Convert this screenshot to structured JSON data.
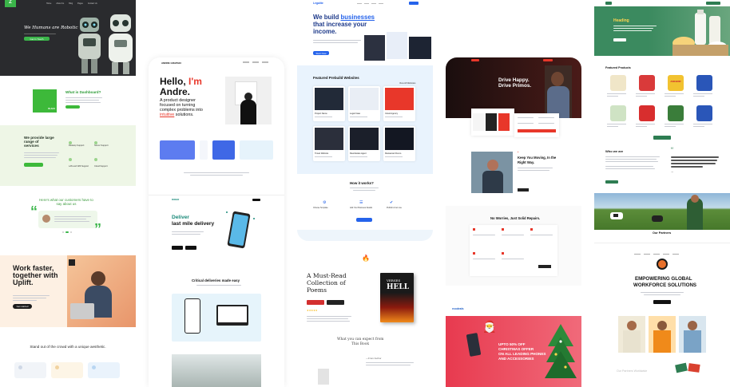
{
  "col1": {
    "hero_logo": "Z",
    "hero_nav": [
      "Home",
      "About Us",
      "Blog",
      "Pages",
      "Contact Us"
    ],
    "hero_heading": "We Humans are Robotic",
    "hero_cta": "Get In Touch",
    "dashboard_title": "What is Dashboard?",
    "dashboard_badge": "BLACK",
    "services_heading": "We provide large range of services",
    "services": [
      "Desktop Support",
      "Server Support",
      "LAN and Wifi Support",
      "Cloud Support"
    ],
    "testimonial_heading": "Here's what our customers have to say about us",
    "uplift_heading": "Work faster, together with Uplift.",
    "uplift_cta": "Get started",
    "crowd_heading": "Stand out of the crowd with a unique aesthetic."
  },
  "col2": {
    "logo": "ANDRE GRAPHIC",
    "hello": "Hello,",
    "im": "I'm",
    "name": "Andre.",
    "intro_lines": [
      "A product designer",
      "focused on turning",
      "complex problems into"
    ],
    "intro_accent": "intuitive",
    "intro_end": "solutions.",
    "delivery_logo": "RIDER",
    "delivery_heading_1": "Deliver",
    "delivery_heading_2": "last mile delivery",
    "critical_heading": "Critical deliveries made easy"
  },
  "col3": {
    "logo": "Legalite",
    "heading_1": "We build",
    "heading_accent": "businesses",
    "heading_2": "that increase your",
    "heading_3": "income.",
    "cta": "Start Now",
    "featured_heading": "Featured Prebuild Websites",
    "featured_link": "View All Websites",
    "sites": [
      "Project Name",
      "Legal Case",
      "Cloud Agency",
      "Travel Website",
      "Real Estate Agent",
      "Restaurant Demo"
    ],
    "how_heading": "How it works?",
    "how_steps": [
      "Choose Template",
      "Add Your Business Details",
      "Publish & Go Live"
    ],
    "book_heading_1": "A Must-Read",
    "book_heading_2": "Collection of",
    "book_heading_3": "Poems",
    "book_cover_title": "VERSES",
    "book_cover_big": "HELL",
    "expect_heading_1": "What you can expect from",
    "expect_heading_2": "This Book",
    "book_quote": "—From Author"
  },
  "col4": {
    "drive_heading_1": "Drive Happy.",
    "drive_heading_2": "Drive Primos.",
    "moving_heading_1": "Keep You Moving, In the",
    "moving_heading_2": "Right Way.",
    "repairs_heading": "No Worries, Just Solid Repairs.",
    "shop_logo": "ecodeals",
    "promo_lines": [
      "UPTO 50% OFF",
      "CHRISTMAS OFFER",
      "ON ALL LEADING PHONES",
      "AND ACCESSORIES"
    ]
  },
  "col5": {
    "heading": "Heading",
    "featured_heading": "Featured Products",
    "product_logo": "ANCHOR",
    "who_heading": "Who we are",
    "partners_heading": "Our Partners",
    "workforce_heading_1": "EMPOWERING GLOBAL",
    "workforce_heading_2": "WORKFORCE SOLUTIONS",
    "partners_footer": "Our Partners Worldwide"
  },
  "colors": {
    "accent_red": "#e8372a",
    "uplift_orange": "#ff7a45",
    "blue": "#2563eb",
    "green": "#2e7d52"
  }
}
